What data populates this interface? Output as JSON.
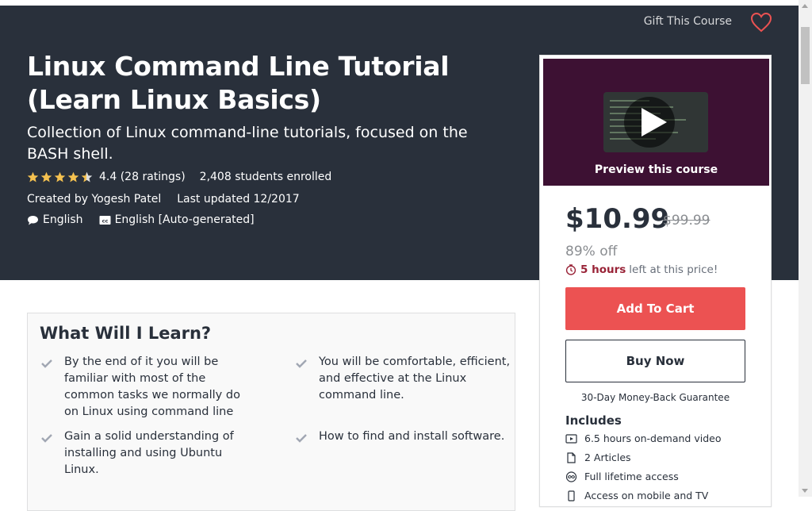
{
  "header": {
    "gift_label": "Gift This Course",
    "wishlist_icon": "heart-icon"
  },
  "course": {
    "title": "Linux Command Line Tutorial (Learn Linux Basics)",
    "subtitle": "Collection of Linux command-line tutorials, focused on the BASH shell.",
    "rating_value": 4.4,
    "rating_text": "4.4 (28 ratings)",
    "students": "2,408 students enrolled",
    "created_by": "Created by Yogesh Patel",
    "last_updated": "Last updated 12/2017",
    "language": "English",
    "captions": "English [Auto-generated]"
  },
  "sidebar": {
    "preview_label": "Preview this course",
    "price": "$10.99",
    "old_price": "$99.99",
    "discount": "89% off",
    "timer_bold": "5 hours",
    "timer_text": "left at this price!",
    "add_to_cart": "Add To Cart",
    "buy_now": "Buy Now",
    "guarantee": "30-Day Money-Back Guarantee",
    "includes_title": "Includes",
    "includes": [
      {
        "icon": "video-icon",
        "label": "6.5 hours on-demand video"
      },
      {
        "icon": "file-icon",
        "label": "2 Articles"
      },
      {
        "icon": "infinity-icon",
        "label": "Full lifetime access"
      },
      {
        "icon": "mobile-icon",
        "label": "Access on mobile and TV"
      }
    ]
  },
  "learn": {
    "title": "What Will I Learn?",
    "items": [
      "By the end of it you will be familiar with most of the common tasks we normally do on Linux using command line",
      "You will be comfortable, efficient, and effective at the Linux command line.",
      "Gain a solid understanding of installing and using Ubuntu Linux.",
      "How to find and install software."
    ]
  },
  "colors": {
    "hero_bg": "#29303b",
    "accent_red": "#ec5252",
    "timer_red": "#992337",
    "star": "#f4c150"
  }
}
